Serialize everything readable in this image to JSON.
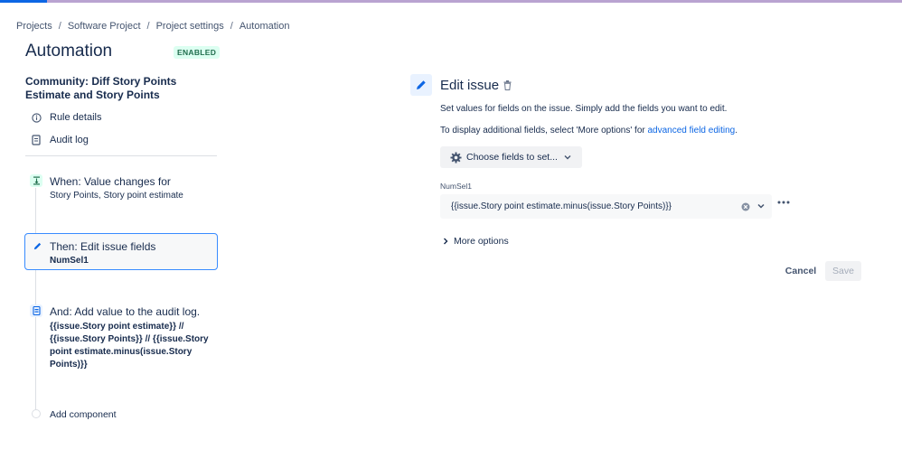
{
  "breadcrumb": {
    "items": [
      "Projects",
      "Software Project",
      "Project settings",
      "Automation"
    ],
    "separator": "/"
  },
  "page": {
    "title": "Automation",
    "status_badge": "ENABLED"
  },
  "rule": {
    "name": "Community: Diff Story Points Estimate and Story Points",
    "links": {
      "rule_details": "Rule details",
      "audit_log": "Audit log"
    }
  },
  "steps": {
    "trigger": {
      "title": "When: Value changes for",
      "subtitle": "Story Points, Story point estimate",
      "icon": "trigger-icon"
    },
    "action": {
      "title": "Then: Edit issue fields",
      "subtitle": "NumSel1",
      "icon": "pencil-icon"
    },
    "audit": {
      "title": "And: Add value to the audit log.",
      "subtitle": "{{issue.Story point estimate}} // {{issue.Story Points}} // {{issue.Story point estimate.minus(issue.Story Points)}}",
      "icon": "audit-log-icon"
    },
    "add_component": "Add component"
  },
  "panel": {
    "title": "Edit issue",
    "desc1": "Set values for fields on the issue. Simply add the fields you want to edit.",
    "desc2_prefix": "To display additional fields, select 'More options' for ",
    "desc2_link": "advanced field editing",
    "desc2_suffix": ".",
    "choose_fields": "Choose fields to set...",
    "field": {
      "label": "NumSel1",
      "value": "{{issue.Story point estimate.minus(issue.Story Points)}}"
    },
    "more_options": "More options",
    "cancel": "Cancel",
    "save": "Save"
  },
  "colors": {
    "accent": "#0c66e4",
    "enabled_badge_bg": "#dcfff1",
    "enabled_badge_text": "#216e4e",
    "selected_border": "#388bff"
  }
}
